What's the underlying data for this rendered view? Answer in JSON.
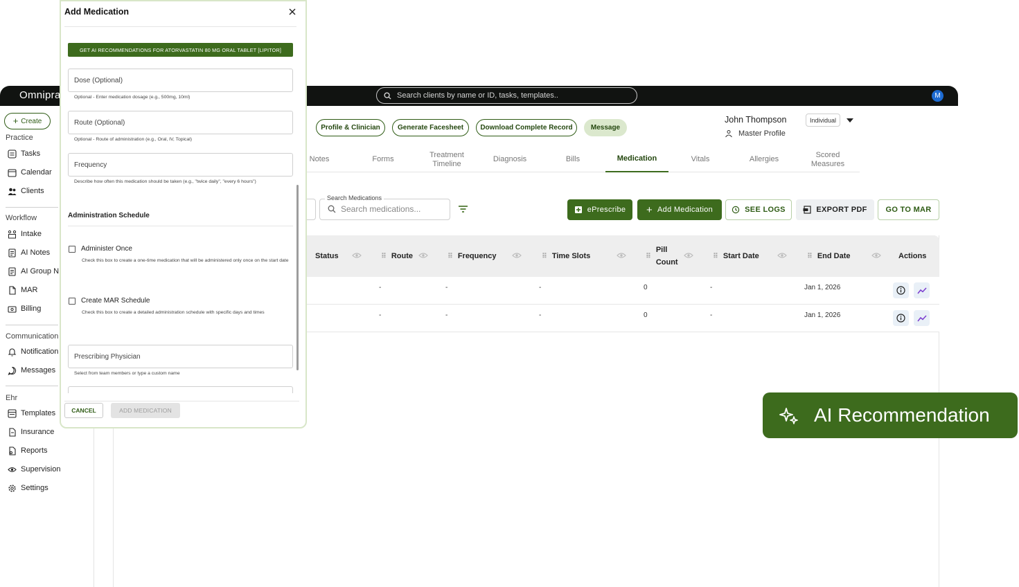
{
  "app": {
    "logo_text": "Omniprac",
    "search_placeholder": "Search clients by name or ID, tasks, templates..",
    "avatar_initial": "M"
  },
  "sidebar": {
    "create_label": "Create",
    "sections": {
      "practice": "Practice",
      "workflow": "Workflow",
      "communication": "Communication",
      "ehr": "Ehr"
    },
    "items": {
      "tasks": "Tasks",
      "calendar": "Calendar",
      "clients": "Clients",
      "intake": "Intake",
      "ai_notes": "AI Notes",
      "ai_group": "AI Group N",
      "mar": "MAR",
      "billing": "Billing",
      "notifications": "Notification",
      "messages": "Messages",
      "templates": "Templates",
      "insurance": "Insurance",
      "reports": "Reports",
      "supervision": "Supervision",
      "settings": "Settings"
    }
  },
  "client_header": {
    "buttons": {
      "profile": "Profile & Clinician",
      "facesheet": "Generate Facesheet",
      "download": "Download Complete Record",
      "message": "Message"
    },
    "client_name": "John Thompson",
    "profile_type": "Individual",
    "master_profile": "Master Profile"
  },
  "tabs": [
    "Notes",
    "Forms",
    "Treatment Timeline",
    "Diagnosis",
    "Bills",
    "Medication",
    "Vitals",
    "Allergies",
    "Scored Measures"
  ],
  "medication": {
    "search_label": "Search Medications",
    "search_placeholder": "Search medications...",
    "actions": {
      "eprescribe": "ePrescribe",
      "add": "Add Medication",
      "logs": "SEE LOGS",
      "export": "EXPORT PDF",
      "mar": "GO TO MAR"
    },
    "columns": {
      "status": "Status",
      "route": "Route",
      "frequency": "Frequency",
      "time_slots": "Time Slots",
      "pill_count_1": "Pill",
      "pill_count_2": "Count",
      "start_date": "Start Date",
      "end_date": "End Date",
      "actions": "Actions"
    },
    "rows": [
      {
        "route": "-",
        "frequency": "-",
        "time_slots": "-",
        "pill_count": "0",
        "start_date": "-",
        "end_date": "Jan 1, 2026"
      },
      {
        "route": "-",
        "frequency": "-",
        "time_slots": "-",
        "pill_count": "0",
        "start_date": "-",
        "end_date": "Jan 1, 2026"
      }
    ]
  },
  "ai_recommendation": {
    "label": "AI Recommendation"
  },
  "modal": {
    "title": "Add Medication",
    "ai_button": "GET AI RECOMMENDATIONS FOR ATORVASTATIN 80 MG ORAL TABLET [LIPITOR]",
    "dose_placeholder": "Dose (Optional)",
    "dose_help": "Optional - Enter medication dosage (e.g., 500mg, 10ml)",
    "route_placeholder": "Route (Optional)",
    "route_help": "Optional - Route of administration (e.g., Oral, IV, Topical)",
    "frequency_placeholder": "Frequency",
    "frequency_help": "Describe how often this medication should be taken (e.g., \"twice daily\", \"every 6 hours\")",
    "schedule_title": "Administration Schedule",
    "administer_once_label": "Administer Once",
    "administer_once_help": "Check this box to create a one-time medication that will be administered only once on the start date",
    "mar_schedule_label": "Create MAR Schedule",
    "mar_schedule_help": "Check this box to create a detailed administration schedule with specific days and times",
    "physician_placeholder": "Prescribing Physician",
    "physician_help": "Select from team members or type a custom name",
    "cancel": "CANCEL",
    "submit": "ADD MEDICATION"
  },
  "colors": {
    "brand_green": "#3d6b1d",
    "accent_light": "#dbe8cd",
    "topbar": "#111311",
    "avatar": "#1d6bd2"
  }
}
